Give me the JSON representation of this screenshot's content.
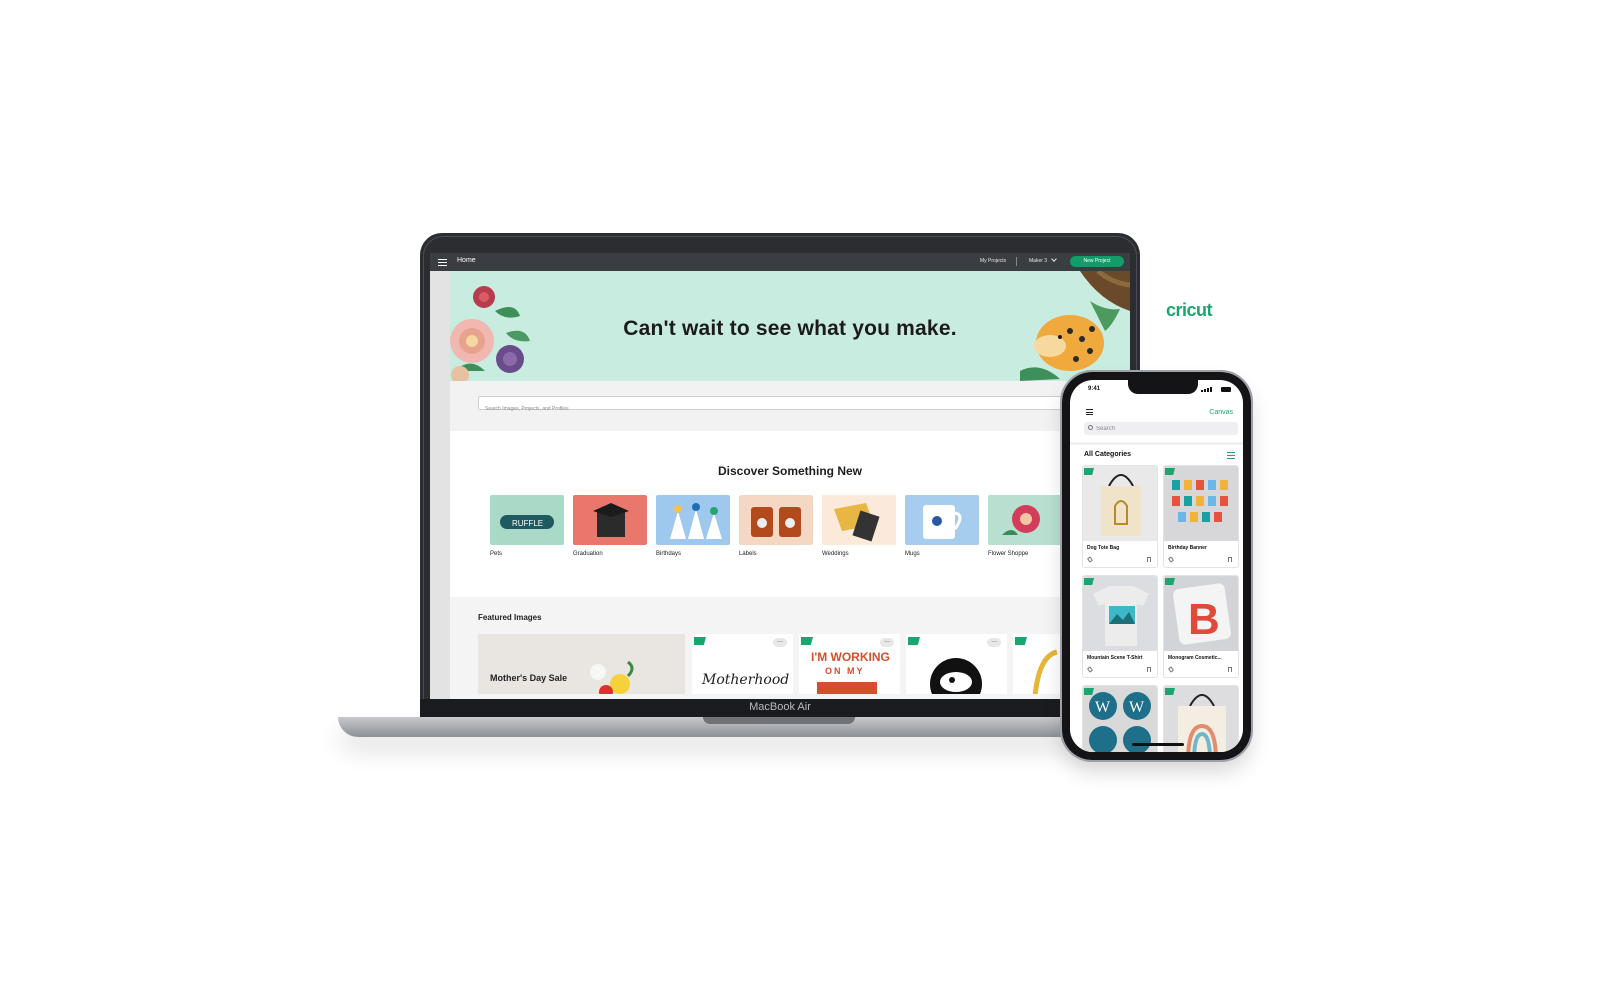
{
  "desktop": {
    "topbar": {
      "title": "Home",
      "my_projects": "My Projects",
      "machine": "Maker 3",
      "new_project": "New Project"
    },
    "hero": {
      "heading": "Can't wait to see what you make."
    },
    "search": {
      "placeholder": "Search Images, Projects, and Profiles"
    },
    "discover": {
      "title": "Discover Something New",
      "categories": [
        {
          "label": "Pets",
          "color": "#a9d9c7"
        },
        {
          "label": "Graduation",
          "color": "#e9776b"
        },
        {
          "label": "Birthdays",
          "color": "#9fc8ee"
        },
        {
          "label": "Labels",
          "color": "#f5d8c4"
        },
        {
          "label": "Weddings",
          "color": "#fbe9d9"
        },
        {
          "label": "Mugs",
          "color": "#a7cdee"
        },
        {
          "label": "Flower Shoppe",
          "color": "#b8dfd0"
        }
      ]
    },
    "featured": {
      "title": "Featured Images",
      "sale_label": "Mother's Day Sale",
      "card_texts": [
        "Motherhood",
        "I'M WORKING",
        "ON MY"
      ]
    },
    "device_label": "MacBook Air"
  },
  "brand": {
    "logo_text": "cricut",
    "color": "#1aa571"
  },
  "mobile": {
    "time": "9:41",
    "canvas_link": "Canvas",
    "search_placeholder": "Search",
    "category_heading": "All Categories",
    "cards": [
      {
        "title": "Dog Tote Bag"
      },
      {
        "title": "Birthday Banner"
      },
      {
        "title": "Mountain Scene T-Shirt"
      },
      {
        "title": "Monogram Cosmetic..."
      }
    ]
  }
}
